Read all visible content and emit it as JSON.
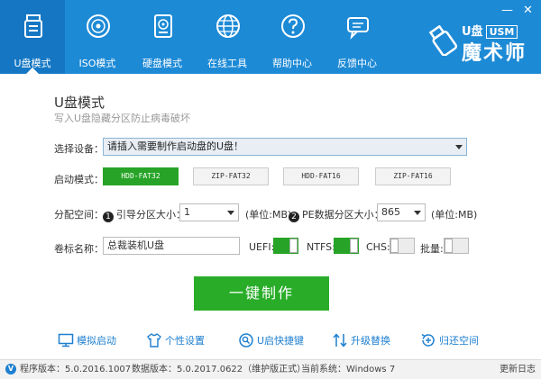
{
  "nav": {
    "items": [
      {
        "label": "U盘模式",
        "icon": "usb-drive-icon",
        "active": true
      },
      {
        "label": "ISO模式",
        "icon": "disc-icon",
        "active": false
      },
      {
        "label": "硬盘模式",
        "icon": "hard-disk-icon",
        "active": false
      },
      {
        "label": "在线工具",
        "icon": "globe-icon",
        "active": false
      },
      {
        "label": "帮助中心",
        "icon": "help-icon",
        "active": false
      },
      {
        "label": "反馈中心",
        "icon": "feedback-icon",
        "active": false
      }
    ]
  },
  "window": {
    "minimize": "—",
    "close": "✕"
  },
  "brand": {
    "top": "U盘",
    "badge": "USM",
    "name": "魔术师"
  },
  "page": {
    "title": "U盘模式",
    "subtitle": "写入U盘隐藏分区防止病毒破坏"
  },
  "device": {
    "label": "选择设备：",
    "value": "请插入需要制作启动盘的U盘！"
  },
  "boot_mode": {
    "label": "启动模式：",
    "options": [
      "HDD-FAT32",
      "ZIP-FAT32",
      "HDD-FAT16",
      "ZIP-FAT16"
    ],
    "selected": "HDD-FAT32"
  },
  "partition": {
    "label": "分配空间：",
    "boot_num": "1",
    "boot_label": "引导分区大小：",
    "boot_value": "1",
    "boot_unit": "(单位:MB)",
    "pe_num": "2",
    "pe_label": "PE数据分区大小：",
    "pe_value": "865",
    "pe_unit": "(单位:MB)"
  },
  "volume": {
    "label": "卷标名称：",
    "value": "总裁装机U盘"
  },
  "toggles": {
    "uefi": {
      "label": "UEFI:",
      "on": true
    },
    "ntfs": {
      "label": "NTFS:",
      "on": true
    },
    "chs": {
      "label": "CHS:",
      "on": false
    },
    "batch": {
      "label": "批量:",
      "on": false
    }
  },
  "make_button": "一键制作",
  "tools": [
    {
      "label": "模拟启动",
      "icon": "monitor-icon"
    },
    {
      "label": "个性设置",
      "icon": "shirt-icon"
    },
    {
      "label": "U启快捷键",
      "icon": "search-key-icon"
    },
    {
      "label": "升级替换",
      "icon": "upgrade-icon"
    },
    {
      "label": "归还空间",
      "icon": "restore-icon"
    }
  ],
  "status": {
    "v_icon": "V",
    "program_version": "程序版本：5.0.2016.1007",
    "data_version": "数据版本：5.0.2017.0622（维护版正式）",
    "current_system": "当前系统：Windows 7",
    "update_log": "更新日志"
  },
  "colors": {
    "header_blue": "#1d8ad6",
    "active_green": "#27a427",
    "link_blue": "#1d7fd0"
  }
}
